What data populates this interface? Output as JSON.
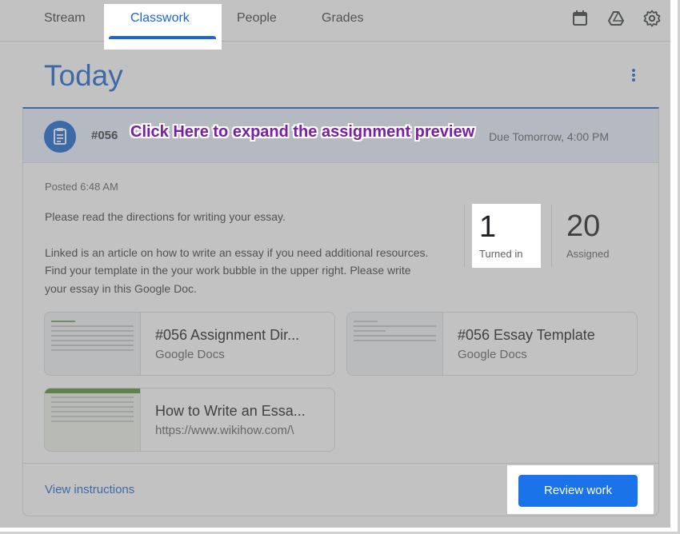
{
  "nav": {
    "tabs": [
      "Stream",
      "Classwork",
      "People",
      "Grades"
    ],
    "active_tab": "Classwork",
    "icons": [
      "calendar-icon",
      "drive-icon",
      "settings-icon"
    ]
  },
  "header": {
    "title": "Today"
  },
  "assignment": {
    "number": "#056",
    "due": "Tomorrow, 4:00 PM",
    "posted": "Posted 6:48 AM",
    "description_line1": "Please read the directions for writing your essay.",
    "description_line2": "Linked is an article on how to write an essay if you need additional resources.",
    "description_line3": "Find your template in the your work bubble in the upper right. Please write",
    "description_line4": "your essay in this Google Doc.",
    "stats": {
      "turned_in_count": "1",
      "turned_in_label": "Turned in",
      "assigned_count": "20",
      "assigned_label": "Assigned"
    },
    "attachments": [
      {
        "title": "#056 Assignment Dir...",
        "subtitle": "Google Docs"
      },
      {
        "title": "#056 Essay Template",
        "subtitle": "Google Docs"
      },
      {
        "title": "How to Write an Essa...",
        "subtitle": "https://www.wikihow.com/\\"
      }
    ],
    "view_instructions": "View instructions",
    "review_button": "Review work"
  },
  "overlay": {
    "callout": "Click Here to expand the assignment preview"
  }
}
